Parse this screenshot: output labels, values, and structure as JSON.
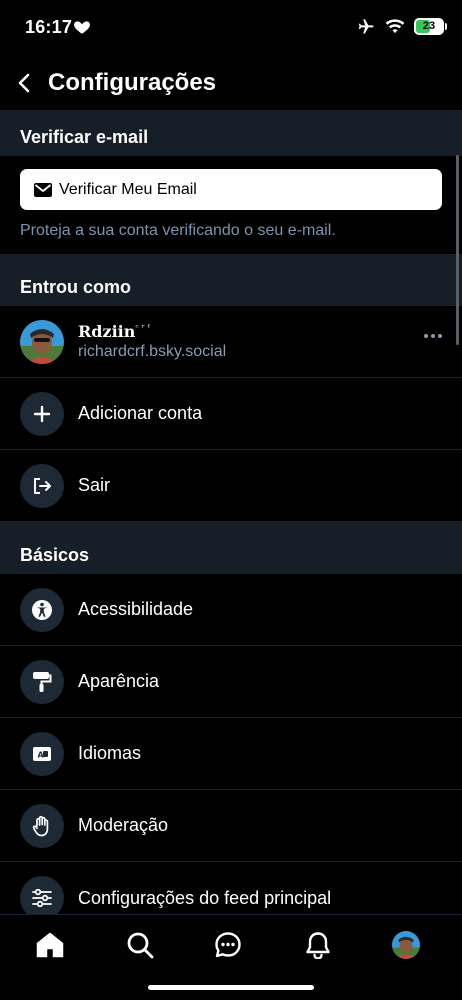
{
  "status_bar": {
    "time": "16:17",
    "battery": "23"
  },
  "header": {
    "title": "Configurações"
  },
  "verify_email": {
    "section_title": "Verificar e-mail",
    "button_label": "Verificar Meu Email",
    "note": "Proteja a sua conta verificando o seu e-mail."
  },
  "signed_in": {
    "section_title": "Entrou como",
    "account": {
      "display_name": "Rdziin",
      "name_suffix": "ᶜʳᶠ",
      "handle": "richardcrf.bsky.social"
    },
    "add_account_label": "Adicionar conta",
    "sign_out_label": "Sair"
  },
  "basics": {
    "section_title": "Básicos",
    "items": [
      {
        "label": "Acessibilidade",
        "icon": "accessibility-icon"
      },
      {
        "label": "Aparência",
        "icon": "paint-roller-icon"
      },
      {
        "label": "Idiomas",
        "icon": "language-icon"
      },
      {
        "label": "Moderação",
        "icon": "hand-icon"
      },
      {
        "label": "Configurações do feed principal",
        "icon": "sliders-icon"
      }
    ]
  },
  "tab_bar": {
    "tabs": [
      "home-icon",
      "search-icon",
      "chat-icon",
      "bell-icon",
      "profile-avatar"
    ]
  },
  "colors": {
    "background": "#000000",
    "section_background": "#161e27",
    "icon_circle": "#1e2936",
    "muted_text": "#7e93ad",
    "battery_green": "#34c759"
  }
}
